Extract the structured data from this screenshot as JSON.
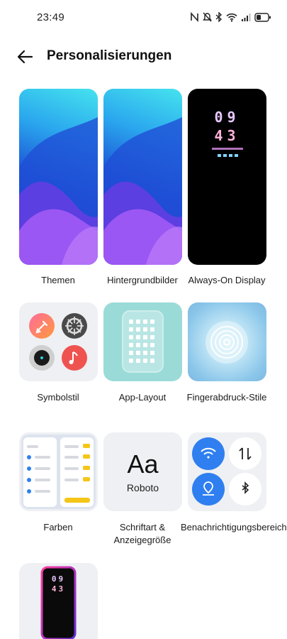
{
  "status_bar": {
    "time": "23:49",
    "icons": [
      "nfc-icon",
      "mute-icon",
      "bluetooth-icon",
      "wifi-icon",
      "signal-icon",
      "battery-icon"
    ]
  },
  "header": {
    "back_icon": "arrow-left-icon",
    "title": "Personalisierungen"
  },
  "items": [
    {
      "label": "Themen"
    },
    {
      "label": "Hintergrundbilder"
    },
    {
      "label": "Always-On Display"
    },
    {
      "label": "Symbolstil"
    },
    {
      "label": "App-Layout"
    },
    {
      "label": "Fingerabdruck-Stile"
    },
    {
      "label": "Farben"
    },
    {
      "label": "Schriftart & Anzeigegröße"
    },
    {
      "label": "Benachrichtigungsbereich"
    },
    {
      "label": ""
    }
  ],
  "aod_preview": {
    "line1": "09",
    "line2": "43"
  },
  "font_preview": {
    "sample": "Aa",
    "font_name": "Roboto"
  },
  "colors": {
    "accent_blue": "#2f7ff0",
    "yellow": "#f5c518"
  }
}
